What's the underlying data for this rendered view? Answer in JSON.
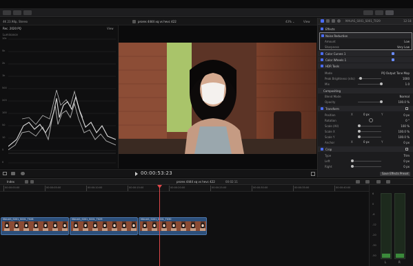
{
  "toolbar": {
    "icons": [
      "import-icon",
      "keywords-icon",
      "background-tasks-icon",
      "layout-icon",
      "browser-icon",
      "inspector-icon"
    ]
  },
  "viewer": {
    "format": "4K 23.98p, Stereo",
    "title": "prores 4444 xq vs hevc 422",
    "zoom": "43%",
    "zoom_caret": "⌄",
    "view_label": "View",
    "scope_title": "Rec. 2020 PQ",
    "scope_view": "View",
    "scope_type": "Luminance",
    "scope_ticks": [
      "10k",
      "5k",
      "2k",
      "1k",
      "500",
      "203",
      "100",
      "50",
      "10",
      "5",
      "0"
    ],
    "timecode": "00:00:53:23"
  },
  "inspector": {
    "clip_name": "MAUAS_S001_S001_T029",
    "clip_duration": "12:18",
    "effects_title": "Effects",
    "noise_reduction": {
      "label": "Noise Reduction",
      "amount_label": "Amount",
      "amount": "Low",
      "sharpness_label": "Sharpness",
      "sharpness": "Very Low"
    },
    "effects": [
      "Color Curves 1",
      "Color Wheels 1",
      "HDR Tools"
    ],
    "hdr": {
      "mode_label": "Mode",
      "mode": "PQ Output Tone Map",
      "peak_label": "Peak Brightness (nits)",
      "peak": "1000",
      "mix_label": "Mix",
      "mix": "1.0"
    },
    "compositing": {
      "title": "Compositing",
      "blend_label": "Blend Mode",
      "blend": "Normal",
      "opacity_label": "Opacity",
      "opacity": "100.0 %"
    },
    "transform": {
      "title": "Transform",
      "position_label": "Position",
      "pos_x_axis": "X",
      "pos_x": "0 px",
      "pos_y_axis": "Y",
      "pos_y": "0 px",
      "rotation_label": "Rotation",
      "rotation": "0 °",
      "scale_all_label": "Scale (All)",
      "scale_all": "100 %",
      "scale_x_label": "Scale X",
      "scale_x": "100.0 %",
      "scale_y_label": "Scale Y",
      "scale_y": "100.0 %",
      "anchor_label": "Anchor",
      "anchor_x_axis": "X",
      "anchor_x": "0 px",
      "anchor_y_axis": "Y",
      "anchor_y": "0 px"
    },
    "crop": {
      "title": "Crop",
      "type_label": "Type",
      "type": "Trim",
      "left_label": "Left",
      "left": "0 px",
      "right_label": "Right",
      "right": "0 px"
    },
    "save_preset": "Save Effects Preset"
  },
  "timeline": {
    "index_label": "Index",
    "project_name": "prores 4444 xq vs hevc 422",
    "project_duration": "00:02:11",
    "ruler_marks": [
      "00:00:00:00",
      "00:00:05:00",
      "00:00:10:00",
      "00:00:15:00",
      "00:00:20:00",
      "00:00:25:00",
      "00:00:30:00",
      "00:00:35:00",
      "00:00:40:00",
      "00:00:45:00"
    ],
    "clips": [
      {
        "name": "MAUAS_S001_S001_T028"
      },
      {
        "name": "MAUAS_S001_S001_T029"
      },
      {
        "name": "MAUAS_S001_S001_T030"
      }
    ],
    "meter_scale": [
      "6",
      "0",
      "-6",
      "-12",
      "-20",
      "-30",
      "-50"
    ],
    "meter_channels": [
      "L",
      "R"
    ]
  }
}
